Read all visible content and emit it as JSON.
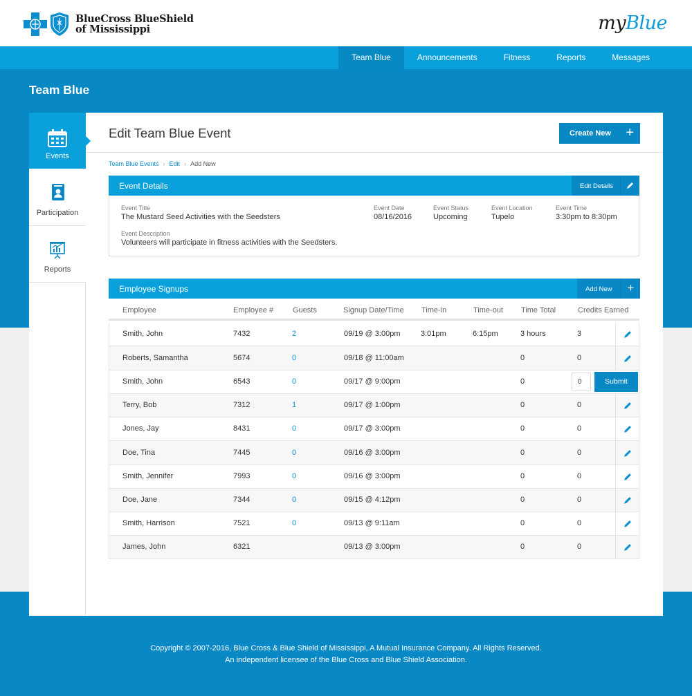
{
  "header": {
    "logo_line1": "BlueCross BlueShield",
    "logo_line2": "of Mississippi",
    "brand_prefix": "my",
    "brand_suffix": "Blue"
  },
  "nav": {
    "items": [
      {
        "label": "Team Blue",
        "active": true
      },
      {
        "label": "Announcements",
        "active": false
      },
      {
        "label": "Fitness",
        "active": false
      },
      {
        "label": "Reports",
        "active": false
      },
      {
        "label": "Messages",
        "active": false
      }
    ]
  },
  "page_heading": "Team Blue",
  "sidebar": {
    "items": [
      {
        "label": "Events",
        "icon": "calendar-icon",
        "active": true
      },
      {
        "label": "Participation",
        "icon": "id-badge-icon",
        "active": false
      },
      {
        "label": "Reports",
        "icon": "presentation-chart-icon",
        "active": false
      }
    ]
  },
  "main": {
    "title": "Edit Team Blue Event",
    "create_label": "Create New",
    "breadcrumbs": [
      "Team Blue Events",
      "Edit",
      "Add New"
    ]
  },
  "event_details": {
    "heading": "Event Details",
    "edit_label": "Edit Details",
    "title_key": "Event Title",
    "title_value": "The Mustard Seed Activities with the Seedsters",
    "date_key": "Event Date",
    "date_value": "08/16/2016",
    "status_key": "Event Status",
    "status_value": "Upcoming",
    "location_key": "Event Location",
    "location_value": "Tupelo",
    "time_key": "Event Time",
    "time_value": "3:30pm to 8:30pm",
    "desc_key": "Event Description",
    "desc_value": "Volunteers will participate in fitness activities with the Seedsters."
  },
  "signups": {
    "heading": "Employee Signups",
    "add_label": "Add New",
    "columns": [
      "Employee",
      "Employee #",
      "Guests",
      "Signup Date/Time",
      "Time-in",
      "Time-out",
      "Time Total",
      "Credits Earned"
    ],
    "rows": [
      {
        "name": "Smith, John",
        "num": "7432",
        "guests": "2",
        "signup": "09/19 @ 3:00pm",
        "timein": "3:01pm",
        "timeout": "6:15pm",
        "total": "3 hours",
        "credits": "3",
        "mode": "edit"
      },
      {
        "name": "Roberts, Samantha",
        "num": "5674",
        "guests": "0",
        "signup": "09/18 @ 11:00am",
        "timein": "",
        "timeout": "",
        "total": "0",
        "credits": "0",
        "mode": "edit"
      },
      {
        "name": "Smith, John",
        "num": "6543",
        "guests": "0",
        "signup": "09/17 @ 9:00pm",
        "timein": "",
        "timeout": "",
        "total": "0",
        "credits": "0",
        "mode": "submit"
      },
      {
        "name": "Terry, Bob",
        "num": "7312",
        "guests": "1",
        "signup": "09/17 @ 1:00pm",
        "timein": "",
        "timeout": "",
        "total": "0",
        "credits": "0",
        "mode": "edit"
      },
      {
        "name": "Jones, Jay",
        "num": "8431",
        "guests": "0",
        "signup": "09/17 @ 3:00pm",
        "timein": "",
        "timeout": "",
        "total": "0",
        "credits": "0",
        "mode": "edit"
      },
      {
        "name": "Doe, Tina",
        "num": "7445",
        "guests": "0",
        "signup": "09/16 @ 3:00pm",
        "timein": "",
        "timeout": "",
        "total": "0",
        "credits": "0",
        "mode": "edit"
      },
      {
        "name": "Smith, Jennifer",
        "num": "7993",
        "guests": "0",
        "signup": "09/16 @ 3:00pm",
        "timein": "",
        "timeout": "",
        "total": "0",
        "credits": "0",
        "mode": "edit"
      },
      {
        "name": "Doe, Jane",
        "num": "7344",
        "guests": "0",
        "signup": "09/15 @ 4:12pm",
        "timein": "",
        "timeout": "",
        "total": "0",
        "credits": "0",
        "mode": "edit"
      },
      {
        "name": "Smith, Harrison",
        "num": "7521",
        "guests": "0",
        "signup": "09/13 @ 9:11am",
        "timein": "",
        "timeout": "",
        "total": "0",
        "credits": "0",
        "mode": "edit"
      },
      {
        "name": "James, John",
        "num": "6321",
        "guests": "",
        "signup": "09/13 @ 3:00pm",
        "timein": "",
        "timeout": "",
        "total": "0",
        "credits": "0",
        "mode": "edit"
      }
    ],
    "credit_input_value": "0",
    "submit_label": "Submit"
  },
  "footer": {
    "line1": "Copyright © 2007-2016, Blue Cross & Blue Shield of Mississippi, A Mutual Insurance Company. All Rights Reserved.",
    "line2": "An independent licensee of the Blue Cross and Blue Shield Association."
  },
  "colors": {
    "primary_blue": "#0888c5",
    "light_blue": "#0aa0dc",
    "link_blue": "#0a8fd0"
  }
}
